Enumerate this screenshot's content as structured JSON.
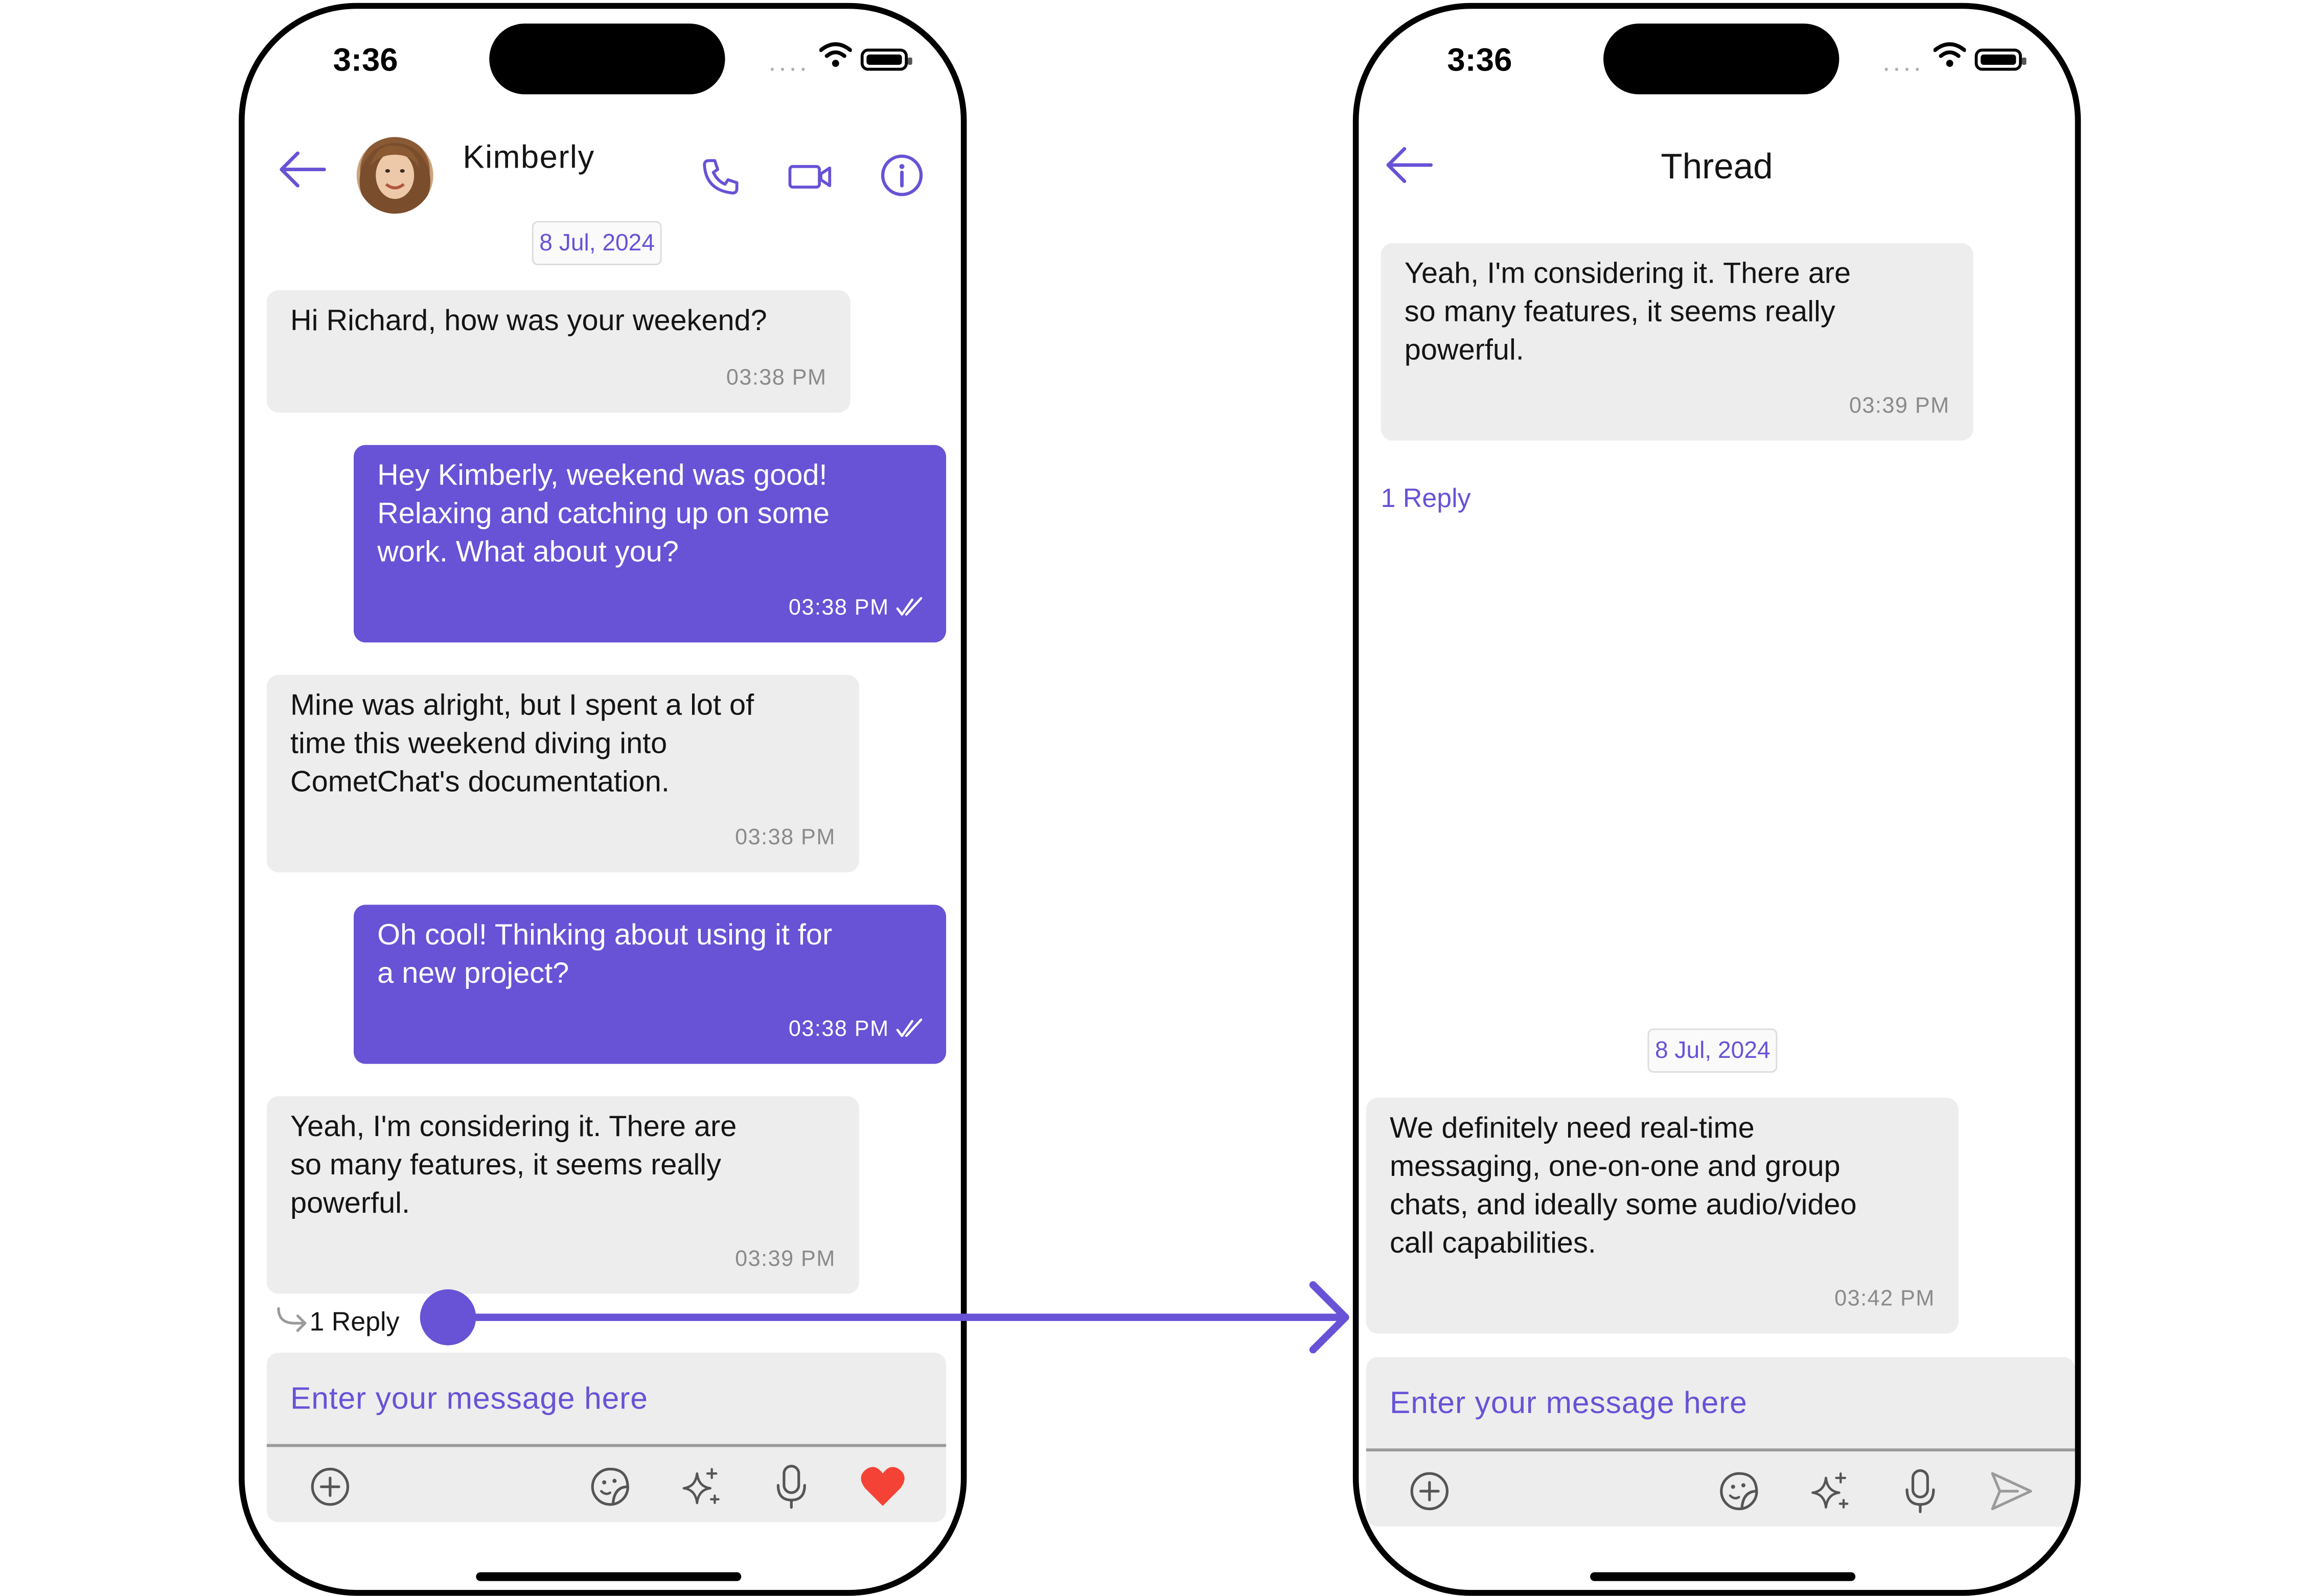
{
  "left_screen": {
    "status": {
      "time": "3:36"
    },
    "header": {
      "contact_name": "Kimberly",
      "icons": [
        "back-arrow-icon",
        "avatar",
        "phone-icon",
        "video-icon",
        "info-icon"
      ]
    },
    "date_separator": "8 Jul, 2024",
    "messages": [
      {
        "direction": "incoming",
        "text": "Hi Richard, how was your weekend?",
        "time": "03:38 PM"
      },
      {
        "direction": "outgoing",
        "text": "Hey Kimberly, weekend was good!\nRelaxing and catching up on some\nwork.  What about you?",
        "time": "03:38 PM",
        "receipt": "double-check-icon"
      },
      {
        "direction": "incoming",
        "text": "Mine was alright, but I spent a lot of\ntime this weekend diving into\nCometChat's documentation.",
        "time": "03:38 PM"
      },
      {
        "direction": "outgoing",
        "text": "Oh cool! Thinking about using it for\na new project?",
        "time": "03:38 PM",
        "receipt": "double-check-icon"
      },
      {
        "direction": "incoming",
        "text": "Yeah, I'm considering it.  There are\nso many features, it seems really\npowerful.",
        "time": "03:39 PM"
      }
    ],
    "thread_reply": "1 Reply",
    "composer": {
      "placeholder": "Enter your message here",
      "icons": [
        "add-icon",
        "sticker-icon",
        "ai-sparkle-icon",
        "mic-icon",
        "heart-icon"
      ]
    }
  },
  "right_screen": {
    "status": {
      "time": "3:36"
    },
    "header": {
      "title": "Thread"
    },
    "parent_message": {
      "text": "Yeah, I'm considering it.  There are\nso many features, it seems really\npowerful.",
      "time": "03:39 PM"
    },
    "reply_count": "1 Reply",
    "date_separator": "8 Jul, 2024",
    "messages": [
      {
        "direction": "incoming",
        "text": "We definitely need real-time\nmessaging, one-on-one and group\nchats, and ideally some audio/video\ncall capabilities.",
        "time": "03:42 PM"
      }
    ],
    "composer": {
      "placeholder": "Enter your message here",
      "icons": [
        "add-icon",
        "sticker-icon",
        "ai-sparkle-icon",
        "mic-icon",
        "send-icon"
      ]
    }
  },
  "colors": {
    "accent": "#6852d6",
    "incoming_bubble": "#ededed",
    "heart": "#f44336"
  }
}
